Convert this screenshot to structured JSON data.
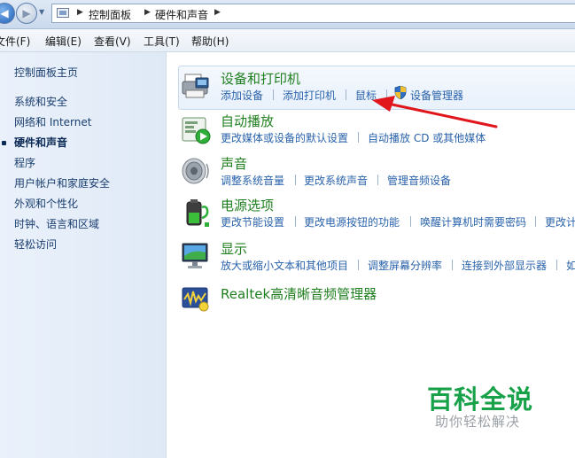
{
  "address": {
    "crumbs": [
      "控制面板",
      "硬件和声音"
    ]
  },
  "menu": {
    "items": [
      "文件(F)",
      "编辑(E)",
      "查看(V)",
      "工具(T)",
      "帮助(H)"
    ]
  },
  "sidebar": {
    "home": "控制面板主页",
    "items": [
      {
        "label": "系统和安全",
        "active": false
      },
      {
        "label": "网络和 Internet",
        "active": false
      },
      {
        "label": "硬件和声音",
        "active": true
      },
      {
        "label": "程序",
        "active": false
      },
      {
        "label": "用户帐户和家庭安全",
        "active": false
      },
      {
        "label": "外观和个性化",
        "active": false
      },
      {
        "label": "时钟、语言和区域",
        "active": false
      },
      {
        "label": "轻松访问",
        "active": false
      }
    ]
  },
  "categories": [
    {
      "title": "设备和打印机",
      "icon": "printer-icon",
      "links": [
        "添加设备",
        "添加打印机",
        "鼠标",
        "设备管理器"
      ]
    },
    {
      "title": "自动播放",
      "icon": "autoplay-icon",
      "links": [
        "更改媒体或设备的默认设置",
        "自动播放 CD 或其他媒体"
      ]
    },
    {
      "title": "声音",
      "icon": "speaker-icon",
      "links": [
        "调整系统音量",
        "更改系统声音",
        "管理音频设备"
      ]
    },
    {
      "title": "电源选项",
      "icon": "battery-icon",
      "links": [
        "更改节能设置",
        "更改电源按钮的功能",
        "唤醒计算机时需要密码",
        "更改计"
      ]
    },
    {
      "title": "显示",
      "icon": "monitor-icon",
      "links": [
        "放大或缩小文本和其他项目",
        "调整屏幕分辨率",
        "连接到外部显示器",
        "如"
      ]
    },
    {
      "title": "Realtek高清晰音频管理器",
      "icon": "realtek-audio-icon",
      "links": []
    }
  ],
  "watermark": {
    "title": "百科全说",
    "subtitle": "助你轻松解决"
  },
  "colors": {
    "category_title": "#1f7f1f",
    "link": "#2a63ab",
    "arrow": "#e0161c",
    "watermark": "#17a24a"
  }
}
